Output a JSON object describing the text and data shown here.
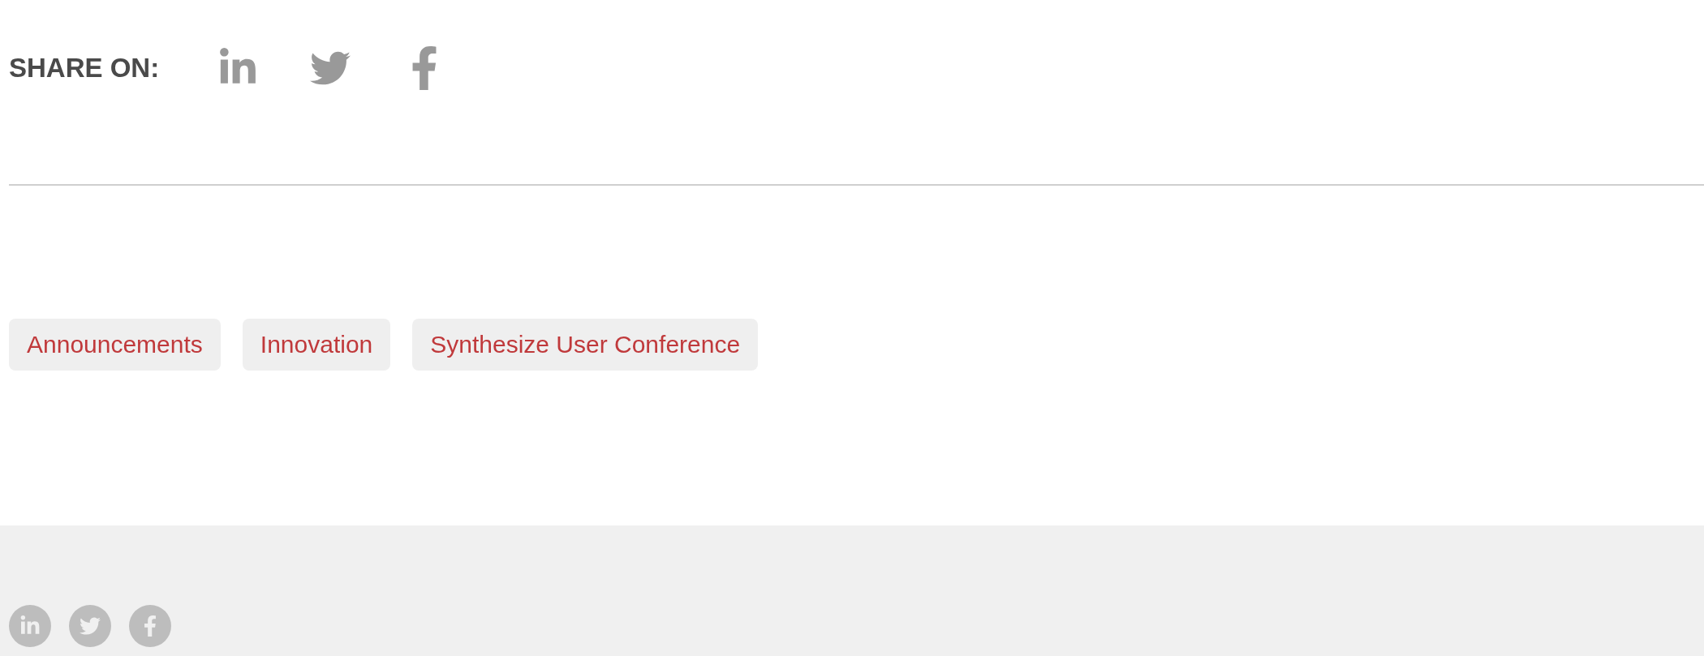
{
  "share": {
    "label": "SHARE ON:",
    "links": [
      {
        "kind": "linkedin"
      },
      {
        "kind": "twitter"
      },
      {
        "kind": "facebook"
      }
    ]
  },
  "tags": [
    "Announcements",
    "Innovation",
    "Synthesize User Conference"
  ],
  "footer": {
    "social": [
      {
        "kind": "linkedin"
      },
      {
        "kind": "twitter"
      },
      {
        "kind": "facebook"
      }
    ]
  }
}
